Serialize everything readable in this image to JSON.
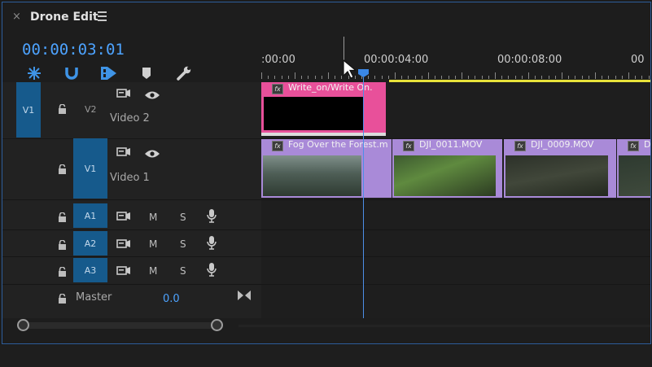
{
  "header": {
    "title": "Drone Edit",
    "close_glyph": "×"
  },
  "timecode": "00:00:03:01",
  "tools": [
    {
      "name": "snap-in-timeline-icon"
    },
    {
      "name": "linked-selection-icon"
    },
    {
      "name": "insert-sequence-icon"
    },
    {
      "name": "add-marker-icon"
    },
    {
      "name": "settings-wrench-icon"
    }
  ],
  "ruler": {
    "marks": [
      ":00:00",
      "00:00:04:00",
      "00:00:08:00",
      "00"
    ]
  },
  "tracks": {
    "v2": {
      "source": "V1",
      "target": "V2",
      "name": "Video 2"
    },
    "v1": {
      "target": "V1",
      "name": "Video 1"
    },
    "a1": {
      "target": "A1",
      "mute": "M",
      "solo": "S"
    },
    "a2": {
      "target": "A2",
      "mute": "M",
      "solo": "S"
    },
    "a3": {
      "target": "A3",
      "mute": "M",
      "solo": "S"
    },
    "master": {
      "label": "Master",
      "value": "0.0"
    }
  },
  "clips": {
    "v2": [
      {
        "label": "Write_on/Write On.",
        "fx": "fx"
      }
    ],
    "v1": [
      {
        "label": "Fog Over the Forest.m",
        "fx": "fx"
      },
      {
        "label": "DJI_0011.MOV",
        "fx": "fx"
      },
      {
        "label": "DJI_0009.MOV",
        "fx": "fx"
      },
      {
        "label": "D",
        "fx": "fx"
      }
    ]
  },
  "colors": {
    "accent": "#4da3ff",
    "target_blue": "#165a8c",
    "graphics_clip": "#e8509a",
    "video_clip": "#a98ad8",
    "work_area": "#e8e23a"
  }
}
